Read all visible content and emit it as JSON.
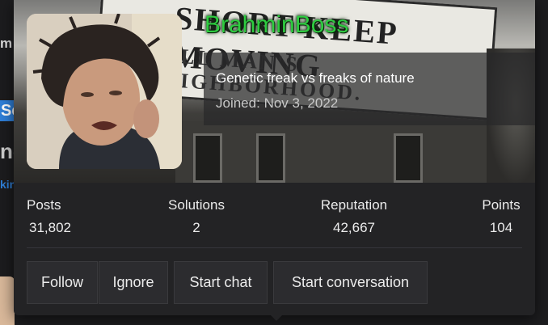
{
  "background_page": {
    "fragment_top": "m",
    "fragment_button": "Se",
    "fragment_heading": "no",
    "fragment_link": "kin"
  },
  "banner": {
    "sign_line1": "SHORT   KEEP MOVING",
    "sign_line2": "TALL MAN'S NEIGHBORHOOD."
  },
  "user": {
    "username": "BrahminBoss",
    "title": "Genetic freak vs freaks of nature",
    "joined_label": "Joined:",
    "joined_date": "Nov 3, 2022",
    "username_color": "#2ecc40"
  },
  "stats": [
    {
      "label": "Posts",
      "value": "31,802"
    },
    {
      "label": "Solutions",
      "value": "2"
    },
    {
      "label": "Reputation",
      "value": "42,667"
    },
    {
      "label": "Points",
      "value": "104"
    }
  ],
  "actions": {
    "follow": "Follow",
    "ignore": "Ignore",
    "start_chat": "Start chat",
    "start_conversation": "Start conversation"
  }
}
